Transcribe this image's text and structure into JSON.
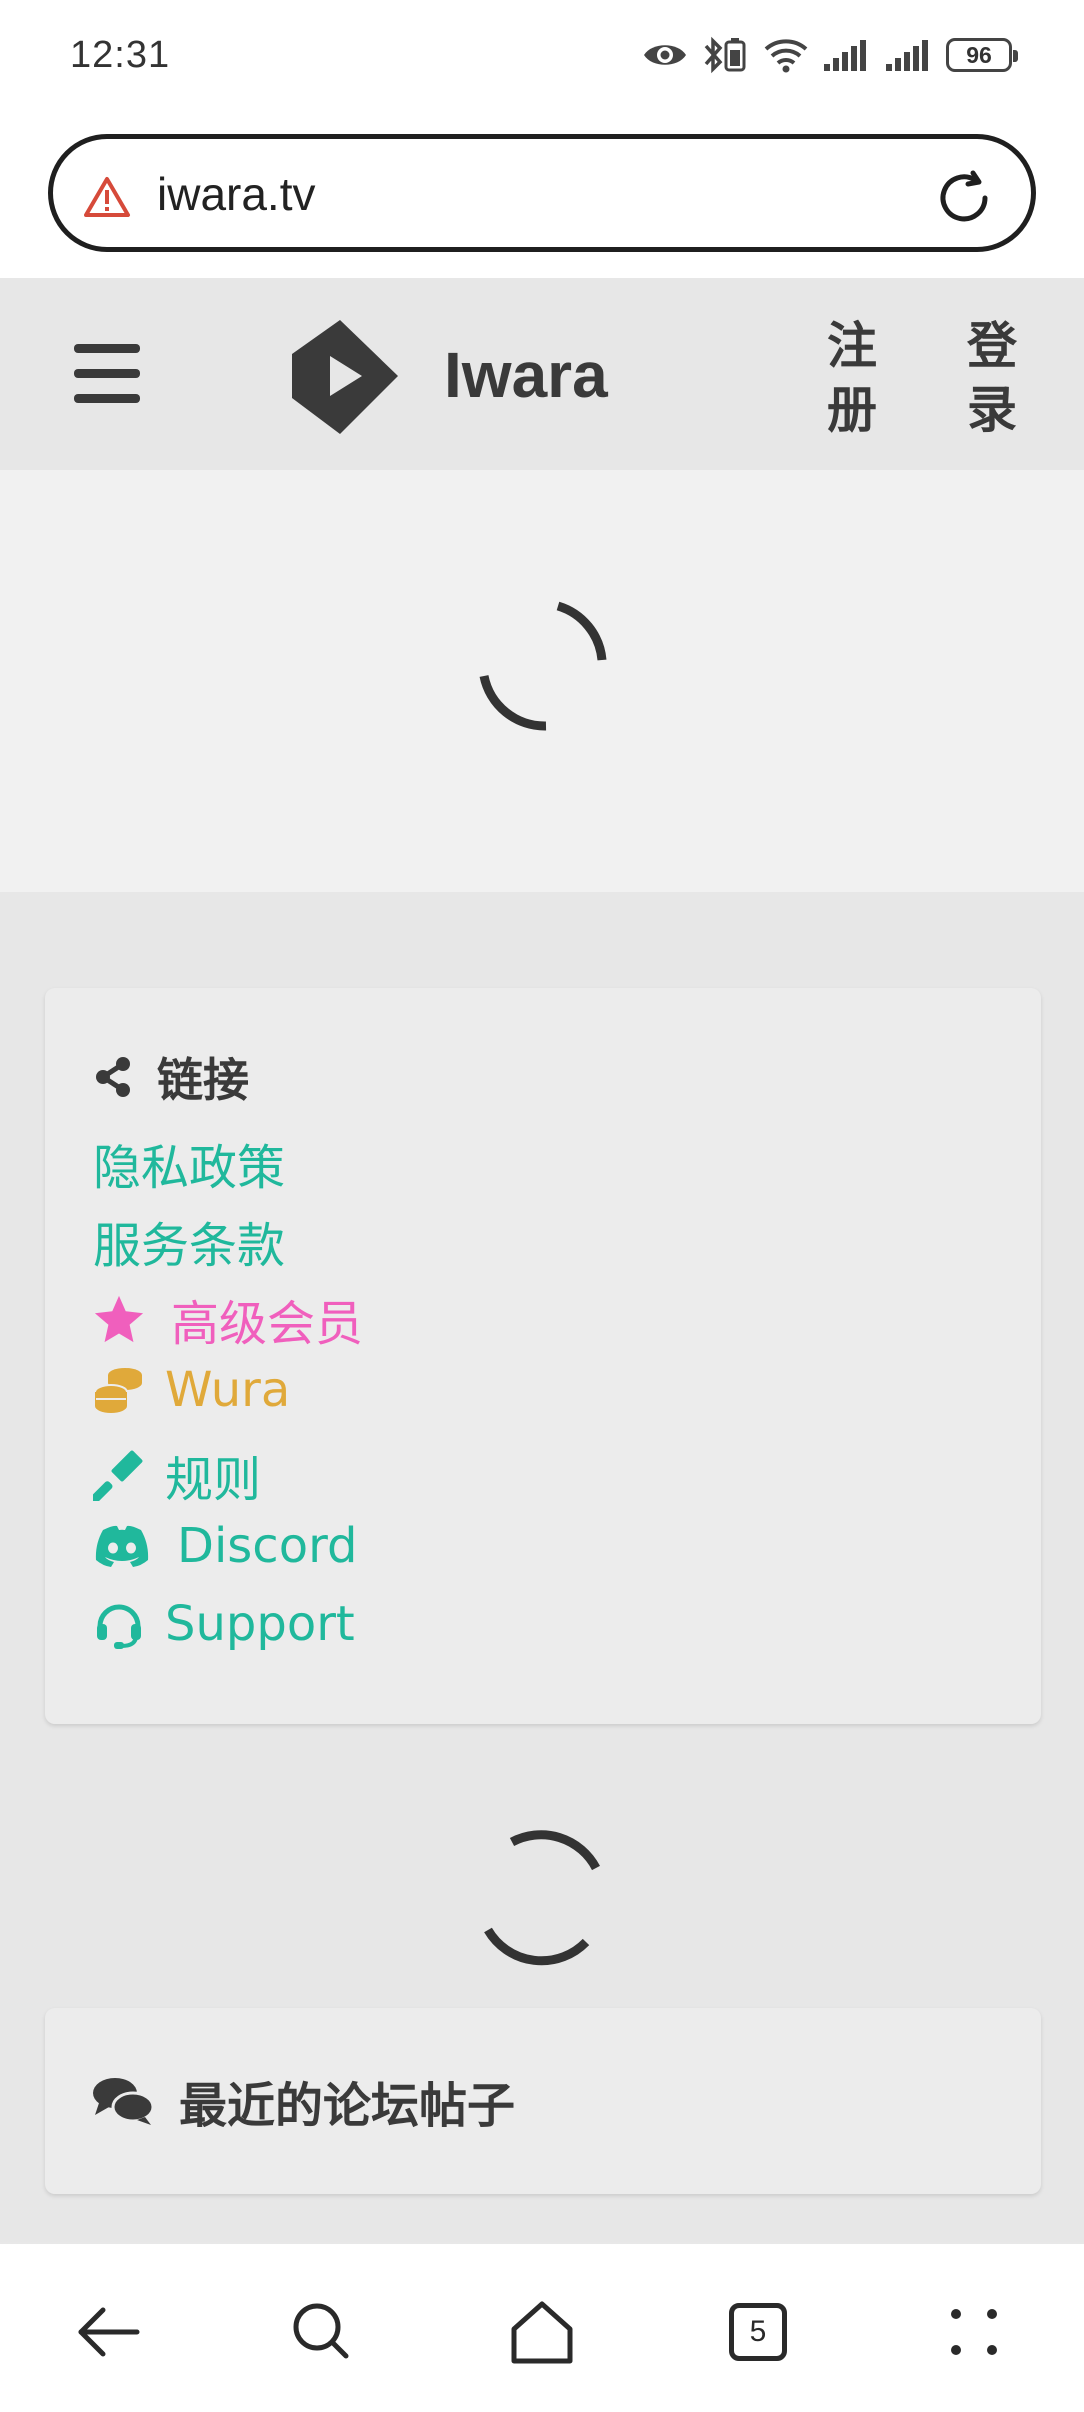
{
  "status_bar": {
    "time": "12:31",
    "battery_level": "96",
    "icons": [
      "eye-icon",
      "bluetooth-icon",
      "wifi-icon",
      "signal-icon",
      "signal-icon",
      "battery-icon"
    ]
  },
  "browser": {
    "url": "iwara.tv",
    "security_icon": "warning-triangle-icon",
    "reload_icon": "reload-icon"
  },
  "header": {
    "brand": "Iwara",
    "register_label": "注册",
    "login_label": "登录"
  },
  "links_card": {
    "title": "链接",
    "items": [
      {
        "label": "隐私政策",
        "icon": null,
        "color": "#20b89c"
      },
      {
        "label": "服务条款",
        "icon": null,
        "color": "#20b89c"
      },
      {
        "label": "高级会员",
        "icon": "star-icon",
        "color": "#f05fbd"
      },
      {
        "label": "Wura",
        "icon": "coins-icon",
        "color": "#e0a93a"
      },
      {
        "label": "规则",
        "icon": "gavel-icon",
        "color": "#20b89c"
      },
      {
        "label": "Discord",
        "icon": "discord-icon",
        "color": "#20b89c"
      },
      {
        "label": "Support",
        "icon": "headset-icon",
        "color": "#20b89c"
      }
    ]
  },
  "forum_card": {
    "title": "最近的论坛帖子"
  },
  "bottom_nav": {
    "tab_count": "5"
  },
  "colors": {
    "accent_teal": "#20b89c",
    "accent_pink": "#f05fbd",
    "accent_gold": "#e0a93a",
    "text_dark": "#3a3a3a"
  }
}
